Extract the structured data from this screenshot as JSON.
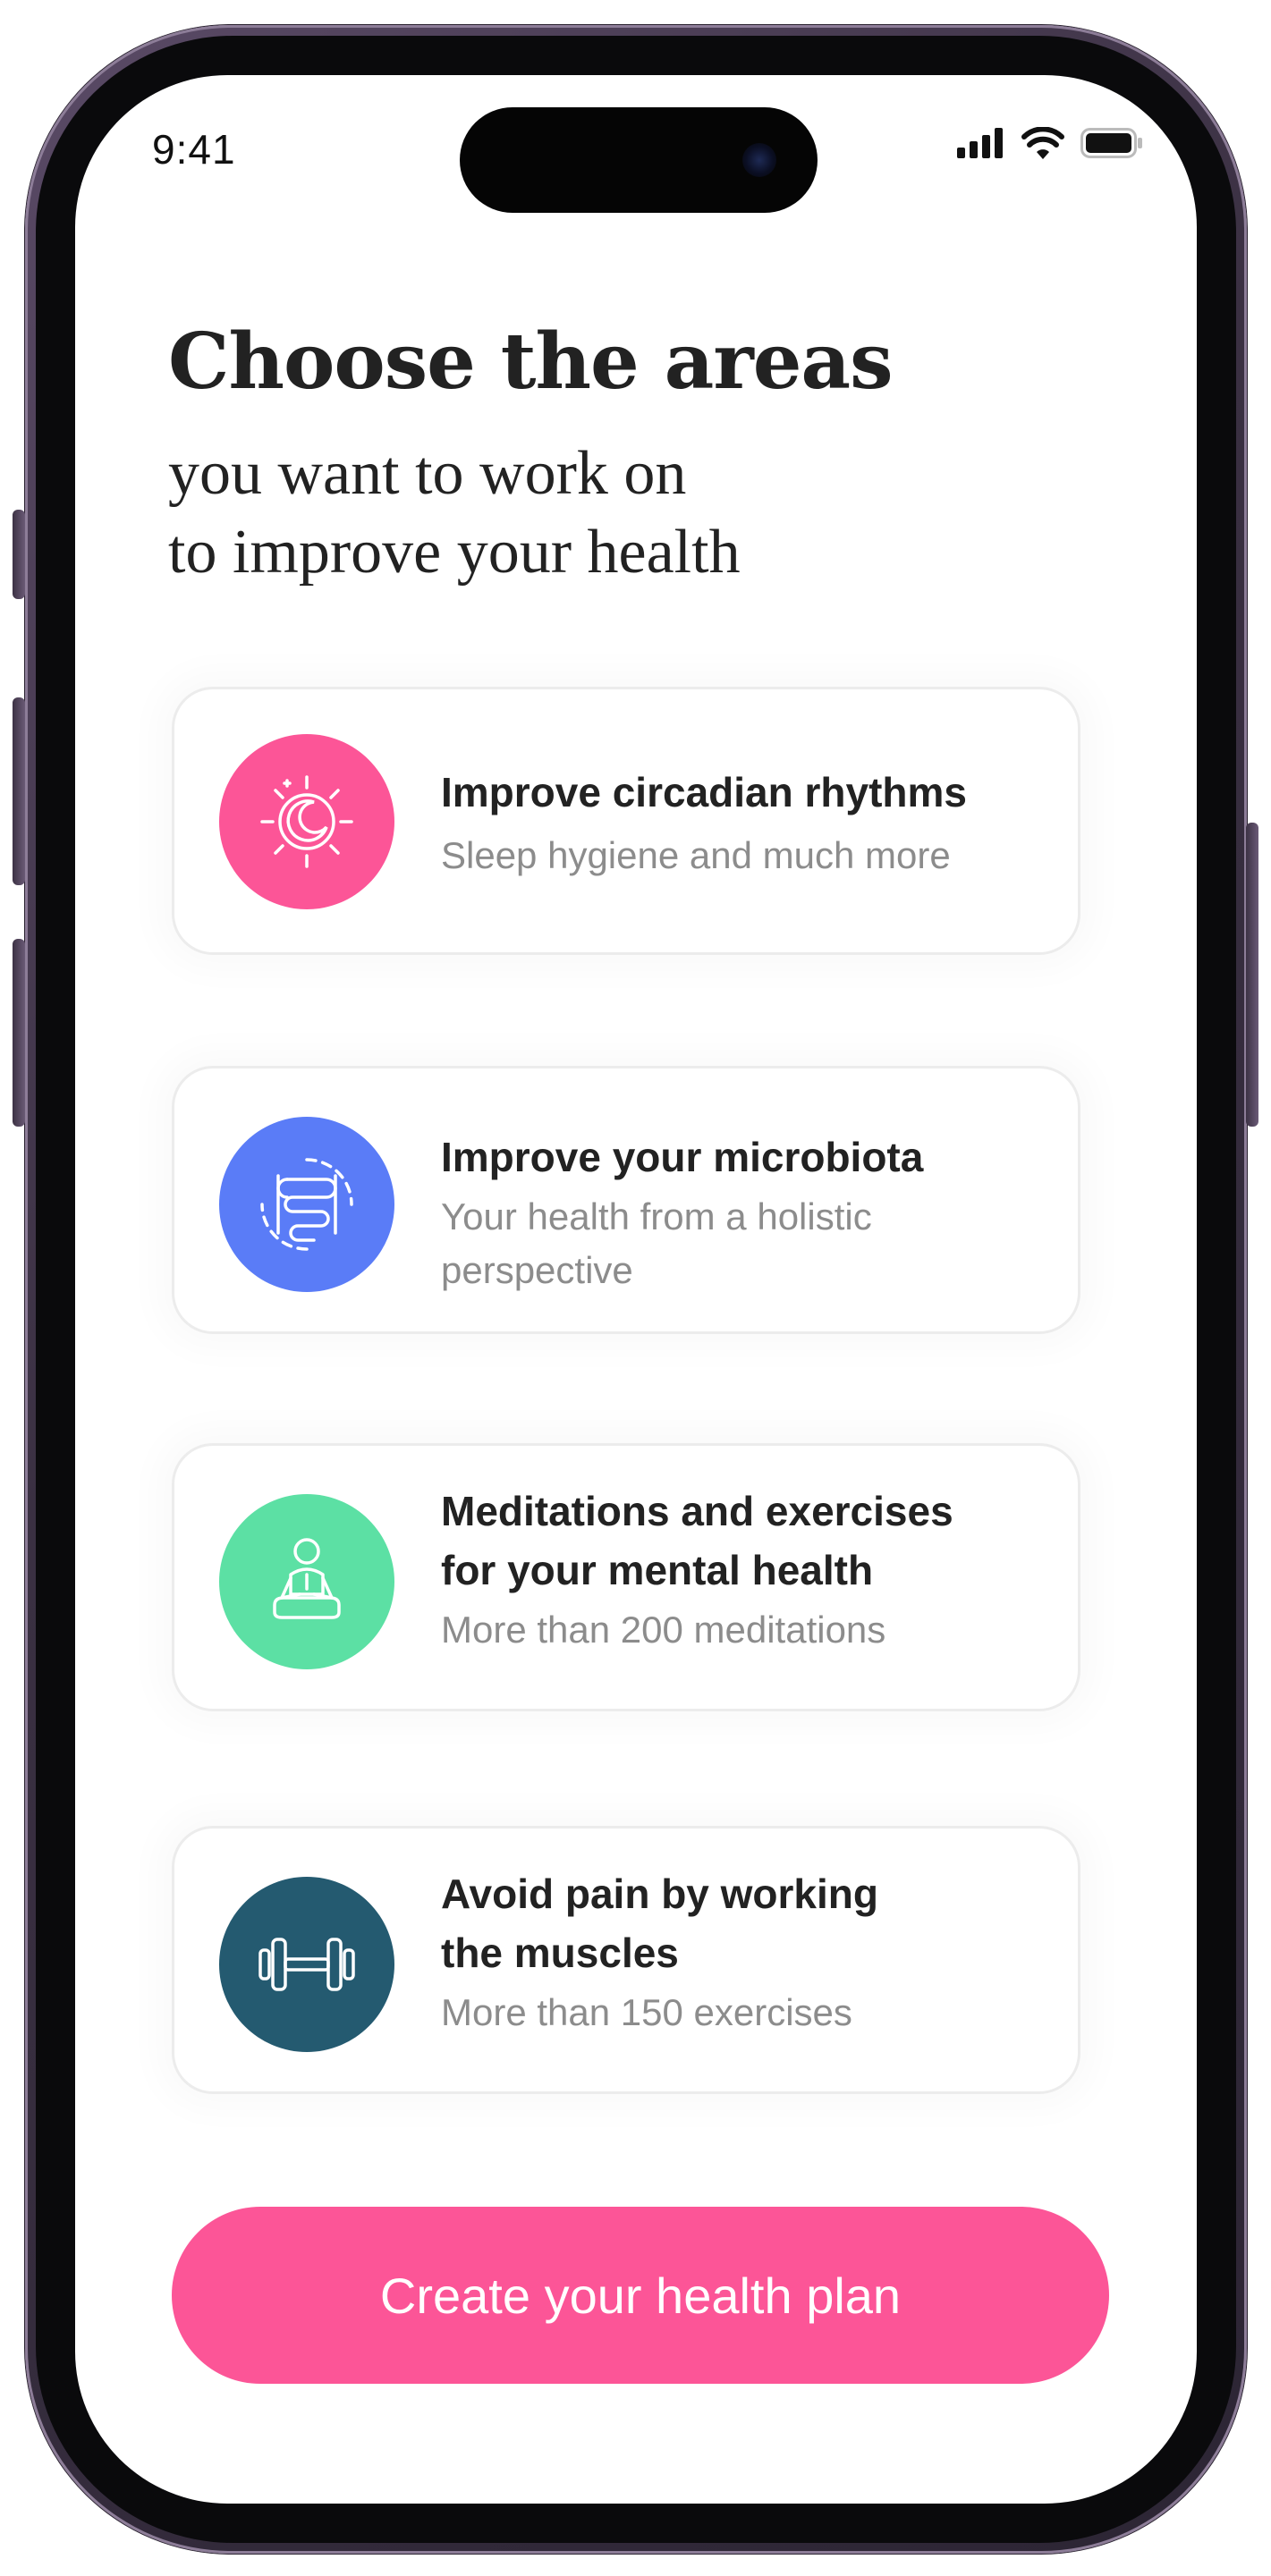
{
  "status_bar": {
    "time": "9:41",
    "icons": [
      "cellular-signal-icon",
      "wifi-icon",
      "battery-icon"
    ]
  },
  "header": {
    "title": "Choose the areas",
    "subtitle_line1": "you want to work on",
    "subtitle_line2": "to improve your health"
  },
  "cards": [
    {
      "icon": "moon-sun-icon",
      "color": "#fc5597",
      "title_line1": "Improve circadian rhythms",
      "title_line2": "",
      "subtitle_line1": "Sleep hygiene and much more",
      "subtitle_line2": ""
    },
    {
      "icon": "intestine-icon",
      "color": "#5a7cf7",
      "title_line1": "Improve your microbiota",
      "title_line2": "",
      "subtitle_line1": "Your health from a holistic",
      "subtitle_line2": "perspective"
    },
    {
      "icon": "meditation-icon",
      "color": "#5ce0a4",
      "title_line1": "Meditations and exercises",
      "title_line2": "for your mental health",
      "subtitle_line1": "More than 200 meditations",
      "subtitle_line2": ""
    },
    {
      "icon": "dumbbell-icon",
      "color": "#245a70",
      "title_line1": "Avoid pain by working",
      "title_line2": "the muscles",
      "subtitle_line1": "More than 150 exercises",
      "subtitle_line2": ""
    }
  ],
  "cta": {
    "label": "Create your health plan",
    "color": "#fc5597"
  }
}
